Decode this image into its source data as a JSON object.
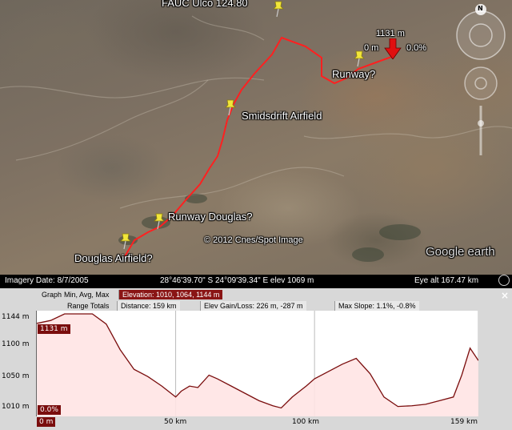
{
  "map": {
    "labels": {
      "top": "FAUC Ulco 124.80",
      "runway_q": "Runway?",
      "smidsdrift": "Smidsdrift Airfield",
      "runway_douglas": "Runway Douglas?",
      "douglas_airfield": "Douglas Airfield?",
      "copyright": "© 2012 Cnes/Spot Image",
      "marker_elev": "1131 m",
      "marker_dist": "0 m",
      "marker_slope": "0.0%",
      "brand": "Google earth",
      "north": "N"
    },
    "route_color": "#ff2020",
    "pin_color": "#f2e63a"
  },
  "status_bar": {
    "imagery_date": "Imagery Date: 8/7/2005",
    "coordinates": "28°46'39.70\" S  24°09'39.34\" E  elev  1069 m",
    "eye_alt": "Eye alt  167.47 km"
  },
  "profile": {
    "row1": {
      "graph_label": "Graph",
      "graph_value": "Min, Avg, Max",
      "elevation": "Elevation: 1010, 1064, 1144 m"
    },
    "row2": {
      "range_totals": "Range Totals",
      "distance": "Distance: 159 km",
      "elev_gain_loss": "Elev Gain/Loss: 226 m, -287 m",
      "max_slope": "Max Slope: 1.1%, -0.8%"
    },
    "close": "×",
    "cursor_elev": "1131 m",
    "cursor_dist": "0 m",
    "cursor_slope": "0.0%",
    "line_color": "#7a0d0d"
  },
  "chart_data": {
    "type": "area",
    "title": "",
    "xlabel": "",
    "ylabel": "",
    "xlim": [
      0,
      159
    ],
    "ylim": [
      1010,
      1144
    ],
    "y_ticks": [
      "1144 m",
      "1100 m",
      "1050 m",
      "1010 m"
    ],
    "x_ticks": [
      "50 km",
      "100 km",
      "159 km"
    ],
    "x": [
      0,
      5,
      10,
      15,
      20,
      25,
      30,
      35,
      40,
      45,
      50,
      52,
      55,
      58,
      62,
      65,
      70,
      75,
      80,
      85,
      88,
      92,
      97,
      100,
      105,
      110,
      115,
      120,
      125,
      130,
      135,
      140,
      145,
      150,
      153,
      156,
      159
    ],
    "values": [
      1131,
      1135,
      1144,
      1144,
      1144,
      1130,
      1095,
      1068,
      1058,
      1045,
      1030,
      1038,
      1045,
      1043,
      1060,
      1055,
      1045,
      1035,
      1025,
      1018,
      1015,
      1030,
      1045,
      1055,
      1065,
      1075,
      1083,
      1062,
      1030,
      1017,
      1018,
      1020,
      1025,
      1030,
      1060,
      1097,
      1080
    ]
  }
}
